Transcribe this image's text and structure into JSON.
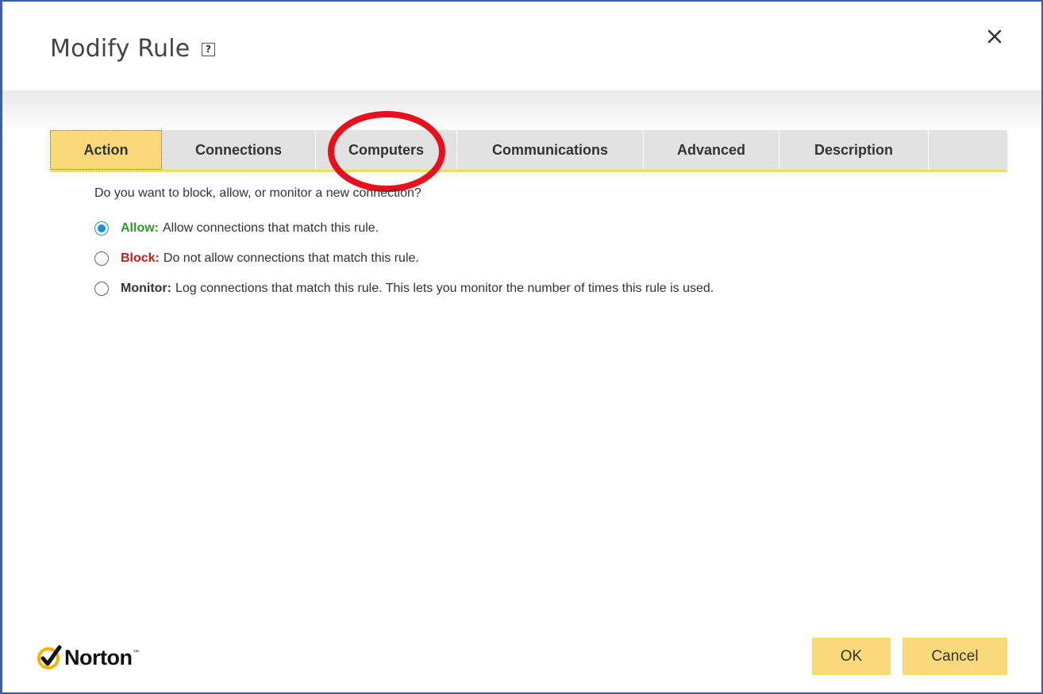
{
  "dialog": {
    "title": "Modify Rule",
    "help_icon": "question-mark-icon",
    "close_icon": "close-icon"
  },
  "tabs": [
    {
      "label": "Action",
      "active": true
    },
    {
      "label": "Connections",
      "active": false
    },
    {
      "label": "Computers",
      "active": false
    },
    {
      "label": "Communications",
      "active": false
    },
    {
      "label": "Advanced",
      "active": false
    },
    {
      "label": "Description",
      "active": false
    }
  ],
  "action": {
    "question": "Do you want to block, allow, or monitor a new connection?",
    "options": [
      {
        "key": "Allow:",
        "text": "Allow connections that match this rule.",
        "selected": true,
        "key_color": "#2e9a2e"
      },
      {
        "key": "Block:",
        "text": "Do not allow connections that match this rule.",
        "selected": false,
        "key_color": "#c0201c"
      },
      {
        "key": "Monitor:",
        "text": "Log connections that match this rule. This lets you monitor the number of times this rule is used.",
        "selected": false,
        "key_color": "#333333"
      }
    ]
  },
  "footer": {
    "brand": "Norton",
    "brand_icon": "norton-checkmark-icon",
    "ok_label": "OK",
    "cancel_label": "Cancel"
  },
  "colors": {
    "accent": "#f9d97a",
    "annotation_ring": "#e8101a",
    "dialog_border": "#3d5fa8",
    "radio_selected": "#1a8fe0"
  }
}
